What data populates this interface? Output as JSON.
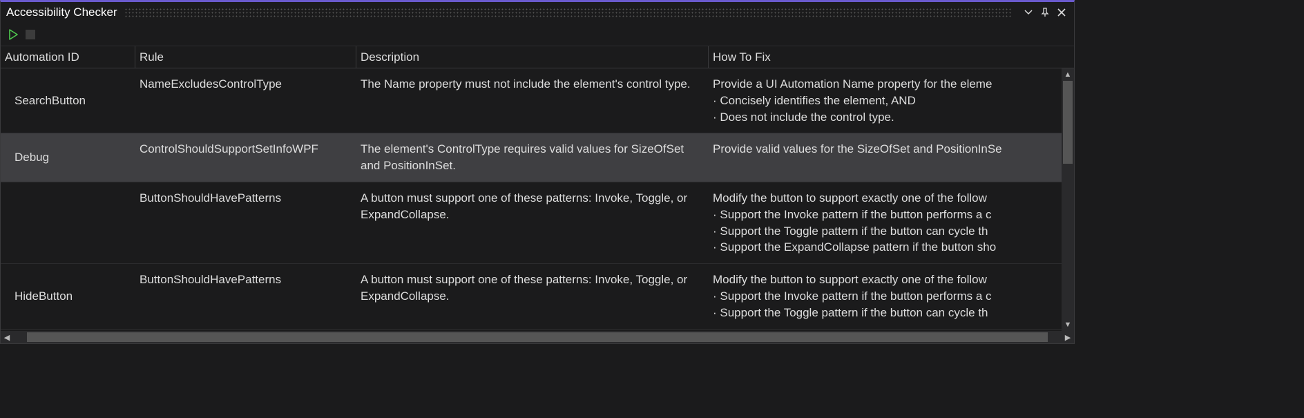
{
  "panel": {
    "title": "Accessibility Checker"
  },
  "columns": {
    "c1": "Automation ID",
    "c2": "Rule",
    "c3": "Description",
    "c4": "How To Fix"
  },
  "rows": [
    {
      "automationId": "SearchButton",
      "rule": "NameExcludesControlType",
      "description": "The Name property must not include the element's control type.",
      "fix0": "Provide a UI Automation Name property for the eleme",
      "fix1": " · Concisely identifies the element, AND",
      "fix2": " · Does not include the control type."
    },
    {
      "automationId": "Debug",
      "rule": "ControlShouldSupportSetInfoWPF",
      "description": "The element's ControlType requires valid values for SizeOfSet and PositionInSet.",
      "fix0": "Provide valid values for the SizeOfSet and PositionInSe"
    },
    {
      "automationId": "",
      "rule": "ButtonShouldHavePatterns",
      "description": "A button must support one of these patterns: Invoke, Toggle, or ExpandCollapse.",
      "fix0": "Modify the button to support exactly one of the follow",
      "fix1": " · Support the Invoke pattern if the button performs a c",
      "fix2": " · Support the Toggle pattern if the button can cycle th",
      "fix3": " · Support the ExpandCollapse pattern if the button sho"
    },
    {
      "automationId": "HideButton",
      "rule": "ButtonShouldHavePatterns",
      "description": "A button must support one of these patterns: Invoke, Toggle, or ExpandCollapse.",
      "fix0": "Modify the button to support exactly one of the follow",
      "fix1": " · Support the Invoke pattern if the button performs a c",
      "fix2": " · Support the Toggle pattern if the button can cycle th"
    }
  ]
}
